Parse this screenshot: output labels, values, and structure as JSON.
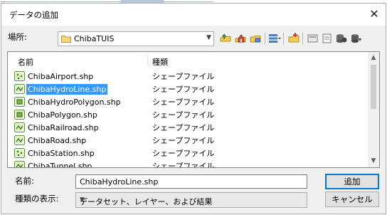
{
  "window": {
    "title": "データの追加"
  },
  "location": {
    "label": "場所:",
    "value": "ChibaTUIS"
  },
  "toolbar": {
    "icons": [
      "up-one-level-icon",
      "home-icon",
      "connect-folder-icon",
      "view-menu-icon",
      "new-folder-icon",
      "catalog-icon",
      "options-icon",
      "database-icon",
      "geodatabase-icon"
    ]
  },
  "list": {
    "columns": {
      "name": "名前",
      "type": "種類"
    },
    "rows": [
      {
        "name": "ChibaAirport.shp",
        "type": "シェープファイル",
        "icon": "point-shapefile-icon",
        "selected": false
      },
      {
        "name": "ChibaHydroLine.shp",
        "type": "シェープファイル",
        "icon": "line-shapefile-icon",
        "selected": true
      },
      {
        "name": "ChibaHydroPolygon.shp",
        "type": "シェープファイル",
        "icon": "polygon-shapefile-icon",
        "selected": false
      },
      {
        "name": "ChibaPolygon.shp",
        "type": "シェープファイル",
        "icon": "polygon-shapefile-icon",
        "selected": false
      },
      {
        "name": "ChibaRailroad.shp",
        "type": "シェープファイル",
        "icon": "line-shapefile-icon",
        "selected": false
      },
      {
        "name": "ChibaRoad.shp",
        "type": "シェープファイル",
        "icon": "line-shapefile-icon",
        "selected": false
      },
      {
        "name": "ChibaStation.shp",
        "type": "シェープファイル",
        "icon": "point-shapefile-icon",
        "selected": false
      },
      {
        "name": "ChibaTunnel.shp",
        "type": "シェープファイル",
        "icon": "line-shapefile-icon",
        "selected": false
      }
    ]
  },
  "name_field": {
    "label": "名前:",
    "value": "ChibaHydroLine.shp"
  },
  "type_filter": {
    "label": "種類の表示:",
    "value": "データセット、レイヤー、および結果"
  },
  "buttons": {
    "add": "追加",
    "cancel": "キャンセル"
  },
  "colors": {
    "selection": "#3399ff",
    "dialog_bg": "#f0f0f0",
    "default_button_border": "#0078d7"
  }
}
